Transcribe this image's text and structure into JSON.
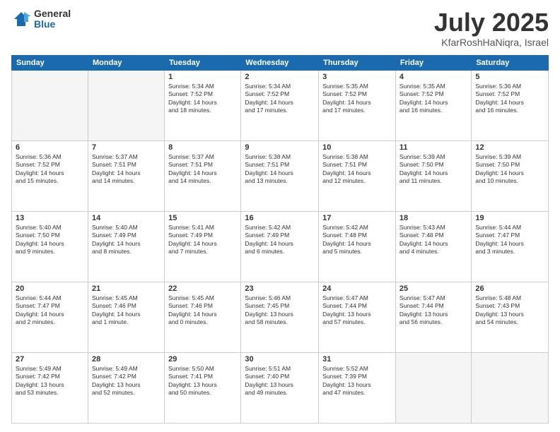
{
  "header": {
    "logo_general": "General",
    "logo_blue": "Blue",
    "title": "July 2025",
    "location": "KfarRoshHaNiqra, Israel"
  },
  "weekdays": [
    "Sunday",
    "Monday",
    "Tuesday",
    "Wednesday",
    "Thursday",
    "Friday",
    "Saturday"
  ],
  "weeks": [
    [
      {
        "day": "",
        "info": ""
      },
      {
        "day": "",
        "info": ""
      },
      {
        "day": "1",
        "info": "Sunrise: 5:34 AM\nSunset: 7:52 PM\nDaylight: 14 hours\nand 18 minutes."
      },
      {
        "day": "2",
        "info": "Sunrise: 5:34 AM\nSunset: 7:52 PM\nDaylight: 14 hours\nand 17 minutes."
      },
      {
        "day": "3",
        "info": "Sunrise: 5:35 AM\nSunset: 7:52 PM\nDaylight: 14 hours\nand 17 minutes."
      },
      {
        "day": "4",
        "info": "Sunrise: 5:35 AM\nSunset: 7:52 PM\nDaylight: 14 hours\nand 16 minutes."
      },
      {
        "day": "5",
        "info": "Sunrise: 5:36 AM\nSunset: 7:52 PM\nDaylight: 14 hours\nand 16 minutes."
      }
    ],
    [
      {
        "day": "6",
        "info": "Sunrise: 5:36 AM\nSunset: 7:52 PM\nDaylight: 14 hours\nand 15 minutes."
      },
      {
        "day": "7",
        "info": "Sunrise: 5:37 AM\nSunset: 7:51 PM\nDaylight: 14 hours\nand 14 minutes."
      },
      {
        "day": "8",
        "info": "Sunrise: 5:37 AM\nSunset: 7:51 PM\nDaylight: 14 hours\nand 14 minutes."
      },
      {
        "day": "9",
        "info": "Sunrise: 5:38 AM\nSunset: 7:51 PM\nDaylight: 14 hours\nand 13 minutes."
      },
      {
        "day": "10",
        "info": "Sunrise: 5:38 AM\nSunset: 7:51 PM\nDaylight: 14 hours\nand 12 minutes."
      },
      {
        "day": "11",
        "info": "Sunrise: 5:39 AM\nSunset: 7:50 PM\nDaylight: 14 hours\nand 11 minutes."
      },
      {
        "day": "12",
        "info": "Sunrise: 5:39 AM\nSunset: 7:50 PM\nDaylight: 14 hours\nand 10 minutes."
      }
    ],
    [
      {
        "day": "13",
        "info": "Sunrise: 5:40 AM\nSunset: 7:50 PM\nDaylight: 14 hours\nand 9 minutes."
      },
      {
        "day": "14",
        "info": "Sunrise: 5:40 AM\nSunset: 7:49 PM\nDaylight: 14 hours\nand 8 minutes."
      },
      {
        "day": "15",
        "info": "Sunrise: 5:41 AM\nSunset: 7:49 PM\nDaylight: 14 hours\nand 7 minutes."
      },
      {
        "day": "16",
        "info": "Sunrise: 5:42 AM\nSunset: 7:49 PM\nDaylight: 14 hours\nand 6 minutes."
      },
      {
        "day": "17",
        "info": "Sunrise: 5:42 AM\nSunset: 7:48 PM\nDaylight: 14 hours\nand 5 minutes."
      },
      {
        "day": "18",
        "info": "Sunrise: 5:43 AM\nSunset: 7:48 PM\nDaylight: 14 hours\nand 4 minutes."
      },
      {
        "day": "19",
        "info": "Sunrise: 5:44 AM\nSunset: 7:47 PM\nDaylight: 14 hours\nand 3 minutes."
      }
    ],
    [
      {
        "day": "20",
        "info": "Sunrise: 5:44 AM\nSunset: 7:47 PM\nDaylight: 14 hours\nand 2 minutes."
      },
      {
        "day": "21",
        "info": "Sunrise: 5:45 AM\nSunset: 7:46 PM\nDaylight: 14 hours\nand 1 minute."
      },
      {
        "day": "22",
        "info": "Sunrise: 5:45 AM\nSunset: 7:46 PM\nDaylight: 14 hours\nand 0 minutes."
      },
      {
        "day": "23",
        "info": "Sunrise: 5:46 AM\nSunset: 7:45 PM\nDaylight: 13 hours\nand 58 minutes."
      },
      {
        "day": "24",
        "info": "Sunrise: 5:47 AM\nSunset: 7:44 PM\nDaylight: 13 hours\nand 57 minutes."
      },
      {
        "day": "25",
        "info": "Sunrise: 5:47 AM\nSunset: 7:44 PM\nDaylight: 13 hours\nand 56 minutes."
      },
      {
        "day": "26",
        "info": "Sunrise: 5:48 AM\nSunset: 7:43 PM\nDaylight: 13 hours\nand 54 minutes."
      }
    ],
    [
      {
        "day": "27",
        "info": "Sunrise: 5:49 AM\nSunset: 7:42 PM\nDaylight: 13 hours\nand 53 minutes."
      },
      {
        "day": "28",
        "info": "Sunrise: 5:49 AM\nSunset: 7:42 PM\nDaylight: 13 hours\nand 52 minutes."
      },
      {
        "day": "29",
        "info": "Sunrise: 5:50 AM\nSunset: 7:41 PM\nDaylight: 13 hours\nand 50 minutes."
      },
      {
        "day": "30",
        "info": "Sunrise: 5:51 AM\nSunset: 7:40 PM\nDaylight: 13 hours\nand 49 minutes."
      },
      {
        "day": "31",
        "info": "Sunrise: 5:52 AM\nSunset: 7:39 PM\nDaylight: 13 hours\nand 47 minutes."
      },
      {
        "day": "",
        "info": ""
      },
      {
        "day": "",
        "info": ""
      }
    ]
  ]
}
